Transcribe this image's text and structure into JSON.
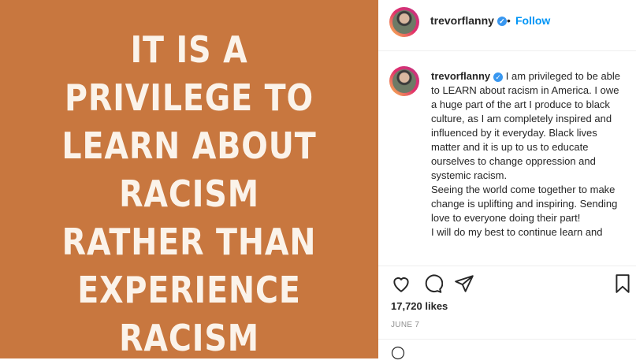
{
  "post_image": {
    "lines": [
      "It is a",
      "privilege to",
      "learn about",
      "racism",
      "rather than",
      "experience",
      "racism"
    ],
    "background": "#c8773f"
  },
  "header": {
    "username": "trevorflanny",
    "dot": "•",
    "follow_label": "Follow"
  },
  "caption": {
    "username": "trevorflanny",
    "paragraphs": [
      "I am privileged to be able to LEARN about racism in America. I owe a huge part of the art I produce to black culture, as I am completely inspired and influenced by it everyday. Black lives matter and it is up to us to educate ourselves to change oppression and systemic racism.",
      "Seeing the world come together to make change is uplifting and inspiring. Sending love to everyone doing their part!",
      "I will do my best to continue learn and"
    ]
  },
  "stats": {
    "likes": "17,720 likes",
    "date": "JUNE 7"
  },
  "colors": {
    "accent": "#0095f6",
    "verified": "#3897f0"
  }
}
